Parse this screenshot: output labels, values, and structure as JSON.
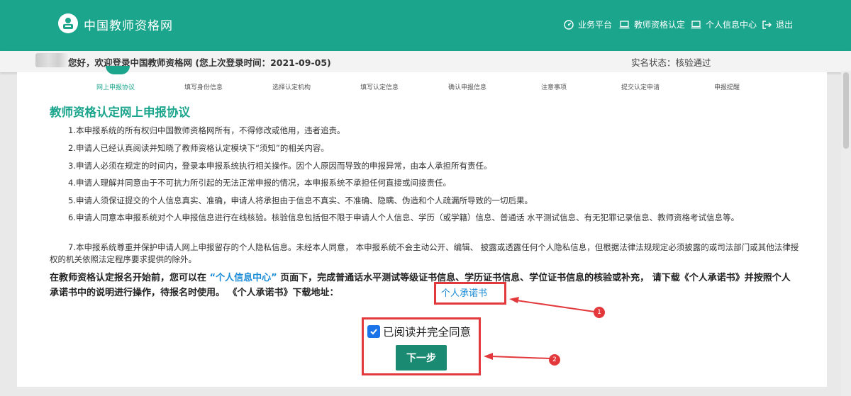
{
  "header": {
    "site_title": "中国教师资格网",
    "nav": [
      {
        "label": "业务平台",
        "icon": "dashboard-icon"
      },
      {
        "label": "教师资格认定",
        "icon": "laptop-icon"
      },
      {
        "label": "个人信息中心",
        "icon": "laptop-icon"
      },
      {
        "label": "退出",
        "icon": "logout-icon"
      }
    ]
  },
  "welcome": {
    "text": "您好，欢迎登录中国教师资格网 (您上次登录时间：2021-09-05)",
    "realname_status": "实名状态：核验通过"
  },
  "steps": [
    {
      "label": "网上申报协议",
      "active": true
    },
    {
      "label": "填写身份信息",
      "active": false
    },
    {
      "label": "选择认定机构",
      "active": false
    },
    {
      "label": "填写认定信息",
      "active": false
    },
    {
      "label": "确认申报信息",
      "active": false
    },
    {
      "label": "注意事项",
      "active": false
    },
    {
      "label": "提交认定申请",
      "active": false
    },
    {
      "label": "申报提醒",
      "active": false
    }
  ],
  "agreement": {
    "title": "教师资格认定网上申报协议",
    "items": [
      "1.本申报系统的所有权归中国教师资格网所有，不得修改或他用，违者追责。",
      "2.申请人已经认真阅读并知晓了教师资格认定模块下“须知”的相关内容。",
      "3.申请人必须在规定的时间内，登录本申报系统执行相关操作。因个人原因而导致的申报异常，由本人承担所有责任。",
      "4.申请人理解并同意由于不可抗力所引起的无法正常申报的情况，本申报系统不承担任何直接或间接责任。",
      "5.申请人须保证提交的个人信息真实、准确，申请人将承担由于信息不真实、不准确、隐瞒、伪造和个人疏漏所导致的一切后果。",
      "6.申请人同意本申报系统对个人申报信息进行在线核验。核验信息包括但不限于申请人个人信息、学历（或学籍）信息、普通话 水平测试信息、有无犯罪记录信息、教师资格考试信息等。",
      "7.本申报系统尊重并保护申请人网上申报留存的个人隐私信息。未经本人同意， 本申报系统不会主动公开、编辑、 披露或透露任何个人隐私信息，但根据法律法规规定必须披露的或司法部门或其他法律授权的机关依照法定程序要求提供的除外。"
    ]
  },
  "notice": {
    "part1": "在教师资格认定报名开始前，您可以在",
    "highlight": "“个人信息中心”",
    "part2": "页面下，完成普通话水平测试等级证书信息、学历证书信息、学位证书信息的核验或补充， 请下载《个人承诺书》并按照个人承诺书中的说明进行操作，待报名时使用。 《个人承诺书》下载地址：",
    "link": "个人承诺书"
  },
  "agree_label": "已阅读并完全同意",
  "next_button": "下一步",
  "annotations": {
    "badge1": "1",
    "badge2": "2"
  },
  "colors": {
    "primary": "#1aa58c",
    "link": "#1a8bd6",
    "annotation": "#e3393c"
  }
}
